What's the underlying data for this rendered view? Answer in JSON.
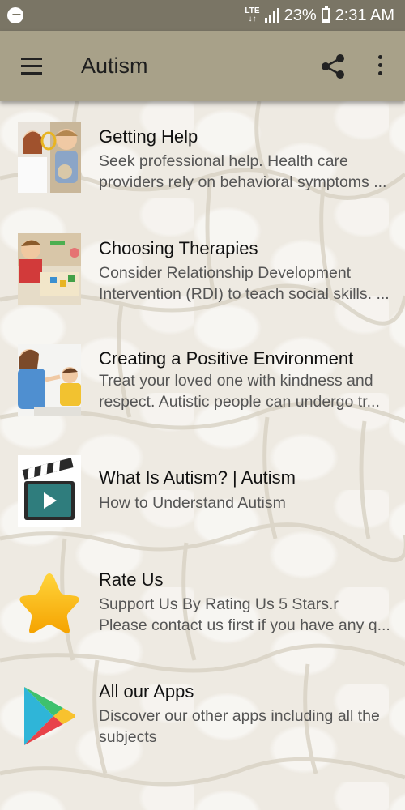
{
  "status_bar": {
    "network": "LTE",
    "battery": "23%",
    "battery_level": 0.23,
    "time": "2:31 AM"
  },
  "app_bar": {
    "title": "Autism",
    "icons": [
      "menu-icon",
      "share-icon",
      "more-vert-icon"
    ]
  },
  "items": [
    {
      "title": "Getting Help",
      "desc_line1": "Seek professional help. Health care",
      "desc_line2": "providers rely on behavioral symptoms ...",
      "thumb": "photo-child-with-doctor"
    },
    {
      "title": "Choosing Therapies",
      "desc_line1": "Consider Relationship Development",
      "desc_line2": "Intervention (RDI) to teach social skills. ...",
      "thumb": "photo-child-playing-at-table"
    },
    {
      "title": "Creating a Positive Environment",
      "desc_line1": "Treat your loved one with kindness and",
      "desc_line2": "respect. Autistic people can undergo tr...",
      "thumb": "photo-woman-with-child"
    },
    {
      "title": "What Is Autism? | Autism",
      "desc_line1": "How to Understand Autism",
      "desc_line2": "",
      "thumb": "video-clapperboard-icon"
    },
    {
      "title": "Rate Us",
      "desc_line1": "Support Us By Rating Us 5 Stars.r",
      "desc_line2": "Please contact us first if you have any q...",
      "thumb": "star-icon"
    },
    {
      "title": "All our Apps",
      "desc_line1": "Discover our other apps including all the",
      "desc_line2": "subjects",
      "thumb": "play-store-icon"
    }
  ],
  "colors": {
    "status_bar": "#7a7565",
    "app_bar": "#a8a189",
    "title_text": "#111111",
    "desc_text": "#555555"
  }
}
